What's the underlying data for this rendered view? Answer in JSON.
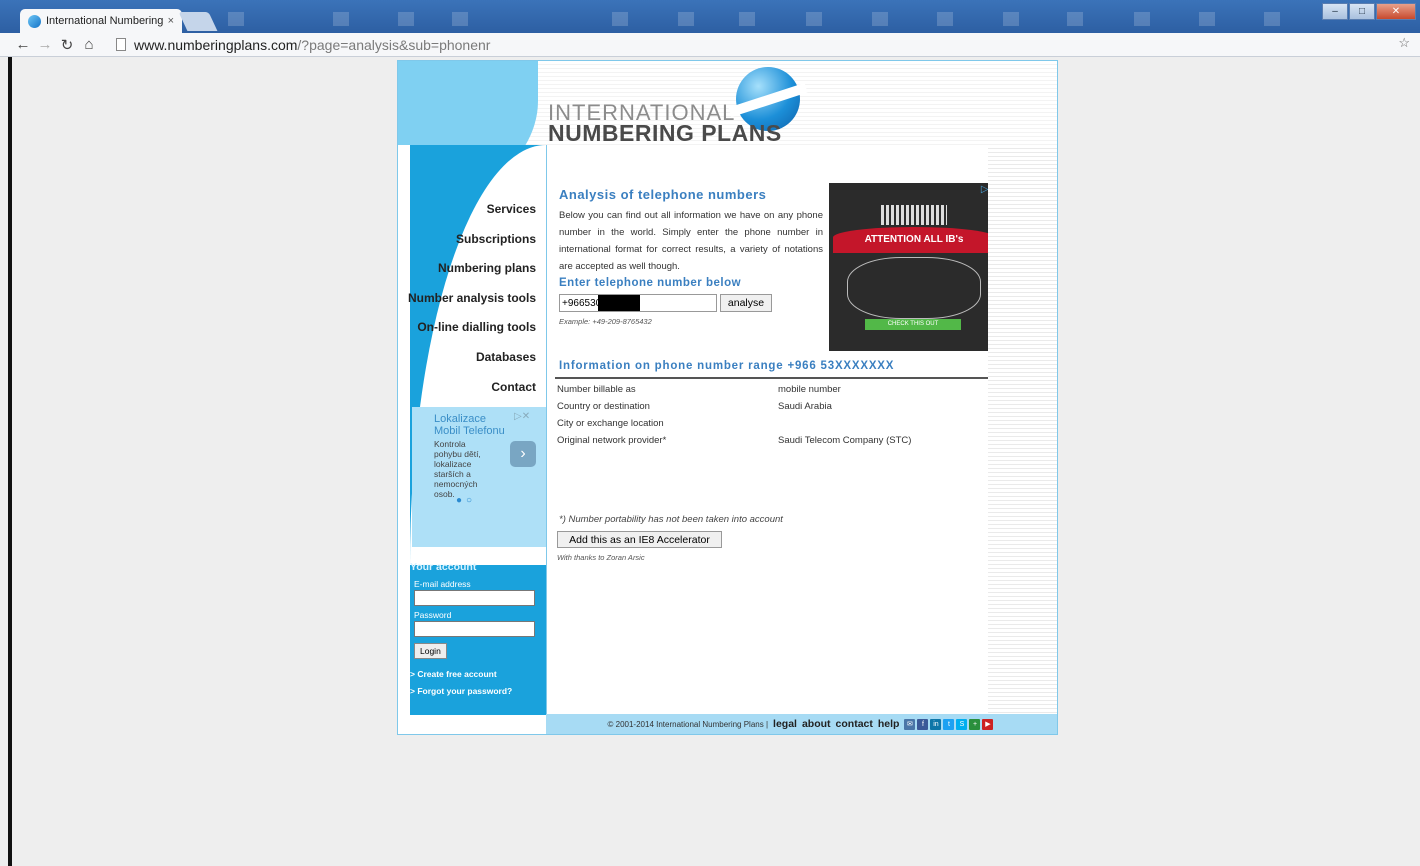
{
  "browser": {
    "tab_title": "International Numbering",
    "tab_close": "×",
    "url_host": "www.numberingplans.com",
    "url_path": "/?page=analysis&sub=phonenr",
    "win_min": "–",
    "win_max": "□",
    "win_close": "✕"
  },
  "header": {
    "logo_line1": "INTERNATIONAL",
    "logo_line2": "NUMBERING PLANS"
  },
  "nav": {
    "items": [
      {
        "label": "Services"
      },
      {
        "label": "Subscriptions"
      },
      {
        "label": "Numbering plans"
      },
      {
        "label": "Number analysis tools"
      },
      {
        "label": "On-line dialling tools"
      },
      {
        "label": "Databases"
      },
      {
        "label": "Contact"
      }
    ]
  },
  "side_ad": {
    "title": "Lokalizace Mobil Telefonu",
    "text": "Kontrola pohybu dětí, lokalizace starších a nemocných osob."
  },
  "account": {
    "title": "Your account",
    "email_label": "E-mail address",
    "password_label": "Password",
    "login_label": "Login",
    "create_link": "> Create free account",
    "forgot_link": "> Forgot your password?"
  },
  "main": {
    "title": "Analysis of telephone numbers",
    "intro": "Below you can find out all information we have on any phone number in the world. Simply enter the phone number in international format for correct results, a variety of notations are accepted as well though.",
    "enter_title": "Enter telephone number below",
    "phone_value": "+966530",
    "analyse_label": "analyse",
    "example": "Example: +49-209-8765432",
    "info_title": "Information on phone number range +966 53XXXXXXX",
    "info_rows": [
      {
        "key": "Number billable as",
        "value": "mobile number"
      },
      {
        "key": "Country or destination",
        "value": "Saudi Arabia"
      },
      {
        "key": "City or exchange location",
        "value": ""
      },
      {
        "key": "Original network provider*",
        "value": "Saudi Telecom Company (STC)"
      }
    ],
    "note": "*) Number portability has not been taken into account",
    "ie8_label": "Add this as an IE8 Accelerator",
    "thanks": "With thanks to Zoran Arsic"
  },
  "ad": {
    "ribbon": "ATTENTION ALL IB's",
    "cta": "CHECK THIS OUT"
  },
  "footer": {
    "copyright": "© 2001-2014 International Numbering Plans |",
    "legal": "legal",
    "about": "about",
    "contact": "contact",
    "help": "help"
  }
}
